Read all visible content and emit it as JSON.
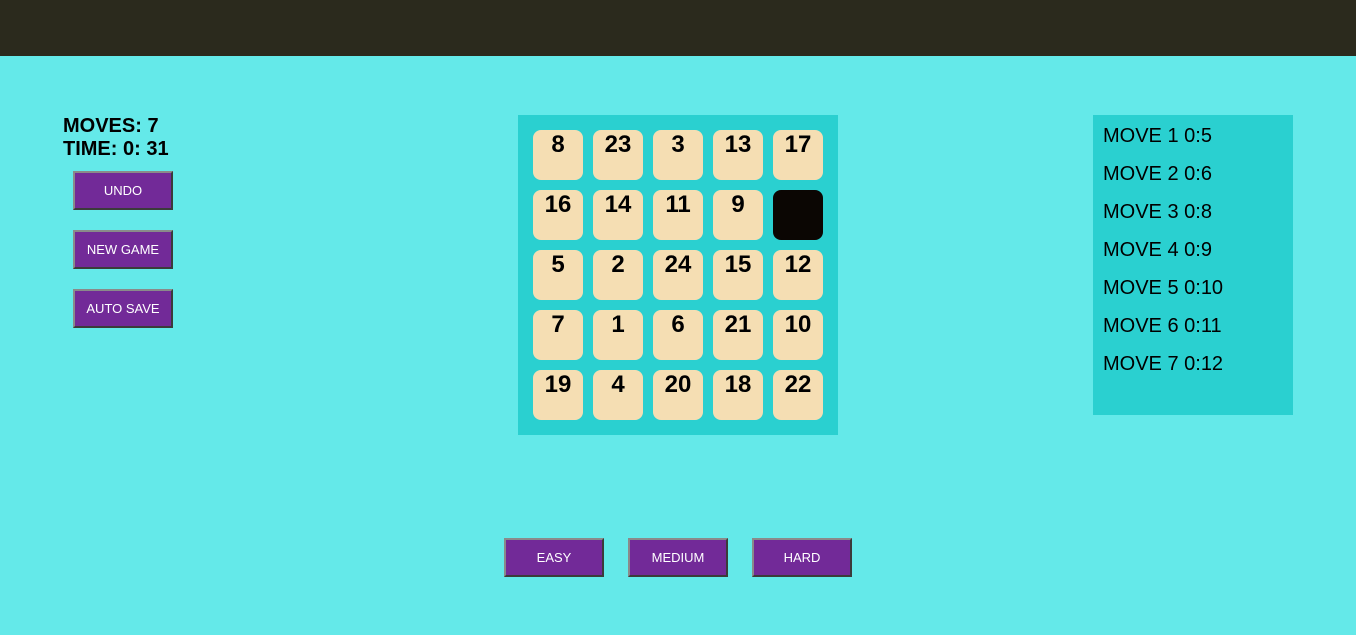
{
  "status": {
    "moves_text": "MOVES: 7",
    "time_text": "TIME: 0: 31"
  },
  "controls": {
    "undo_label": "UNDO",
    "new_game_label": "NEW GAME",
    "auto_save_label": "AUTO SAVE"
  },
  "board": {
    "rows": [
      [
        "8",
        "23",
        "3",
        "13",
        "17"
      ],
      [
        "16",
        "14",
        "11",
        "9",
        ""
      ],
      [
        "5",
        "2",
        "24",
        "15",
        "12"
      ],
      [
        "7",
        "1",
        "6",
        "21",
        "10"
      ],
      [
        "19",
        "4",
        "20",
        "18",
        "22"
      ]
    ],
    "empty_cell": [
      1,
      4
    ],
    "tile_color": "#f5deb3",
    "empty_color": "#0b0603",
    "board_color": "#2ad0d0"
  },
  "history": {
    "items": [
      "MOVE 1 0:5",
      "MOVE 2 0:6",
      "MOVE 3 0:8",
      "MOVE 4 0:9",
      "MOVE 5 0:10",
      "MOVE 6 0:11",
      "MOVE 7 0:12"
    ]
  },
  "difficulty": {
    "easy_label": "EASY",
    "medium_label": "MEDIUM",
    "hard_label": "HARD"
  },
  "colors": {
    "background": "#64e9e9",
    "top_bar": "#2b2a1d",
    "button": "#722a98"
  }
}
